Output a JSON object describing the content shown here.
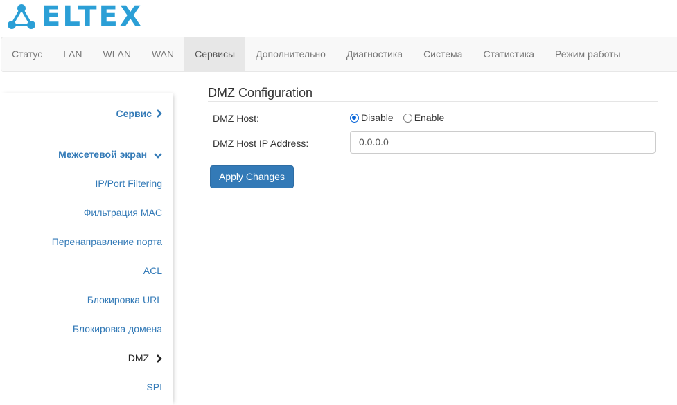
{
  "brand": {
    "logo_text": "ELTEX",
    "color": "#2b9fd6"
  },
  "topnav": {
    "items": [
      {
        "label": "Статус"
      },
      {
        "label": "LAN"
      },
      {
        "label": "WLAN"
      },
      {
        "label": "WAN"
      },
      {
        "label": "Сервисы",
        "active": true
      },
      {
        "label": "Дополнительно"
      },
      {
        "label": "Диагностика"
      },
      {
        "label": "Система"
      },
      {
        "label": "Статистика"
      },
      {
        "label": "Режим работы"
      }
    ]
  },
  "sidebar": {
    "section": "Сервис",
    "group": "Межсетевой экран",
    "items": [
      {
        "label": "IP/Port Filtering"
      },
      {
        "label": "Фильтрация MAC"
      },
      {
        "label": "Перенаправление порта"
      },
      {
        "label": "ACL"
      },
      {
        "label": "Блокировка URL"
      },
      {
        "label": "Блокировка домена"
      },
      {
        "label": "DMZ",
        "current": true
      },
      {
        "label": "SPI"
      }
    ]
  },
  "main": {
    "title": "DMZ Configuration",
    "dmz_host_label": "DMZ Host:",
    "disable_label": "Disable",
    "enable_label": "Enable",
    "selected": "Disable",
    "ip_label": "DMZ Host IP Address:",
    "ip_value": "0.0.0.0",
    "apply_label": "Apply Changes"
  },
  "colors": {
    "accent": "#337ab7",
    "radio": "#0a66d8"
  }
}
